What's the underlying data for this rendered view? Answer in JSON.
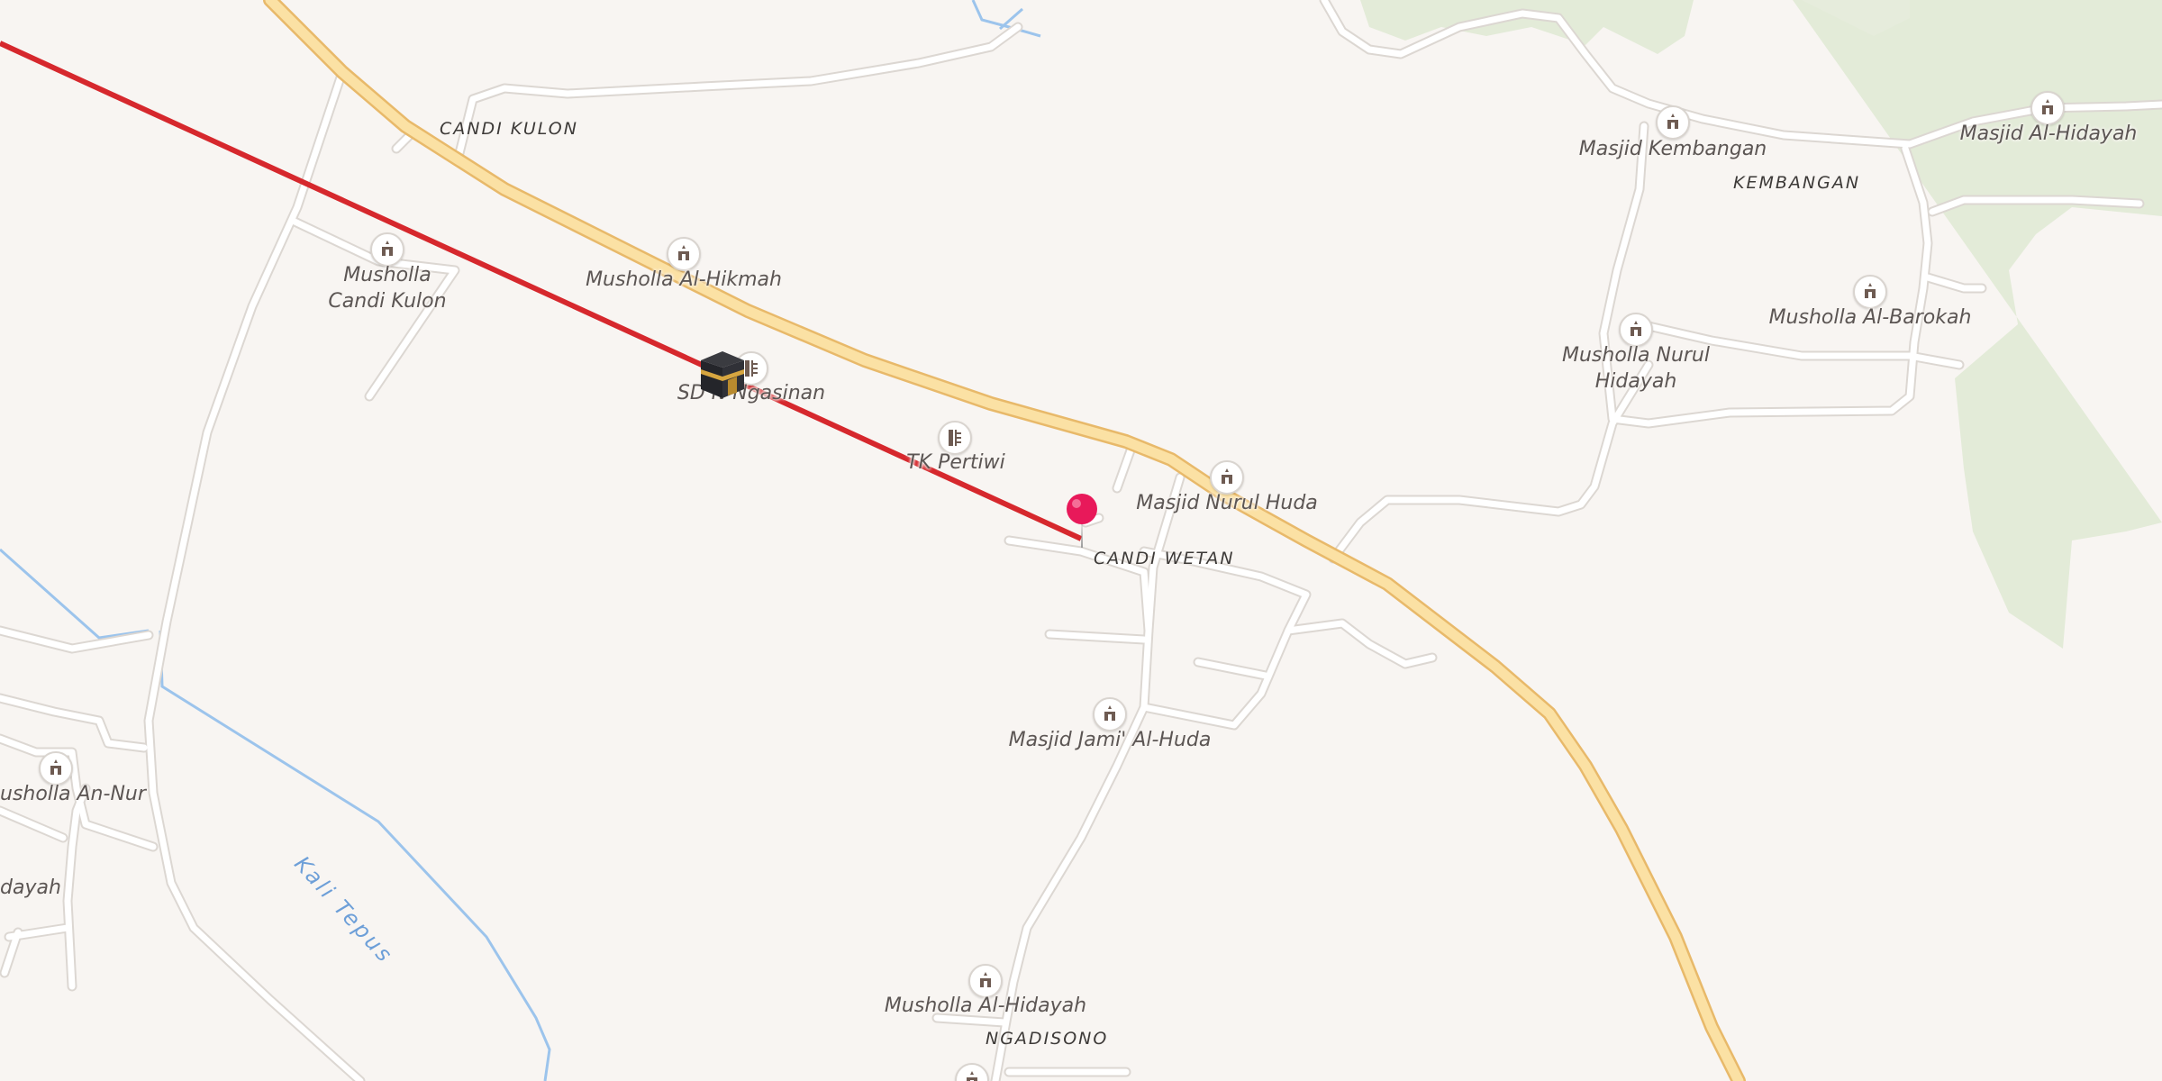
{
  "colors": {
    "background": "#f8f5f2",
    "green_area": "#e3ebd8",
    "road": "#ffffff",
    "road_casing": "#dcd7d2",
    "main_road": "#fbe1a4",
    "main_road_casing": "#e8b96a",
    "water": "#9cc4ec",
    "route_line": "#d6282d",
    "marker": "#e8195a"
  },
  "places": {
    "candi_kulon": "CANDI KULON",
    "candi_wetan": "CANDI WETAN",
    "kembangan": "KEMBANGAN",
    "ngadisono": "NGADISONO"
  },
  "water": {
    "kali_tepus": "Kali Tepus"
  },
  "pois": {
    "musholla_candi_kulon": {
      "label_line1": "Musholla",
      "label_line2": "Candi Kulon",
      "icon": "mosque-icon"
    },
    "musholla_al_hikmah": {
      "label": "Musholla Al-Hikmah",
      "icon": "mosque-icon"
    },
    "sd_n_ngasinan": {
      "label": "SD N Ngasinan",
      "icon": "school-icon"
    },
    "tk_pertiwi": {
      "label": "TK Pertiwi",
      "icon": "school-icon"
    },
    "masjid_nurul_huda": {
      "label": "Masjid Nurul Huda",
      "icon": "mosque-icon"
    },
    "masjid_jami_al_huda": {
      "label": "Masjid Jami' Al-Huda",
      "icon": "mosque-icon"
    },
    "musholla_al_hidayah_south": {
      "label": "Musholla Al-Hidayah",
      "icon": "mosque-icon"
    },
    "musholla_an_nur": {
      "label": "usholla An-Nur",
      "icon": "mosque-icon"
    },
    "dayah_partial": {
      "label": "dayah"
    },
    "masjid_kembangan": {
      "label": "Masjid Kembangan",
      "icon": "mosque-icon"
    },
    "masjid_al_hidayah_east": {
      "label": "Masjid Al-Hidayah",
      "icon": "mosque-icon"
    },
    "musholla_al_barokah": {
      "label": "Musholla Al-Barokah",
      "icon": "mosque-icon"
    },
    "musholla_nurul_hidayah": {
      "label_line1": "Musholla Nurul",
      "label_line2": "Hidayah",
      "icon": "mosque-icon"
    }
  },
  "overlays": {
    "qibla_line": "qibla-direction-line",
    "kaaba": "kaaba-icon",
    "location_pin": "location-pin-icon"
  }
}
